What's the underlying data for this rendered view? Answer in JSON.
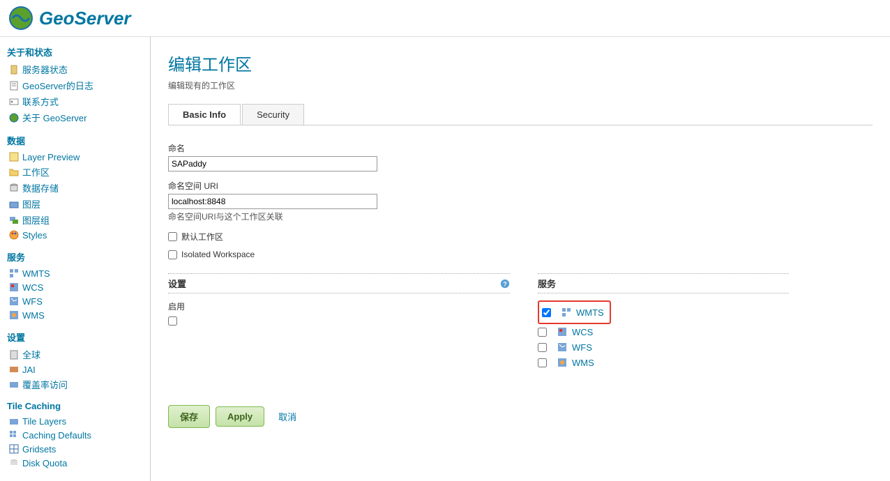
{
  "brand": "GeoServer",
  "sidebar": {
    "groups": [
      {
        "title": "关于和状态",
        "items": [
          {
            "label": "服务器状态",
            "icon": "status-icon"
          },
          {
            "label": "GeoServer的日志",
            "icon": "log-icon"
          },
          {
            "label": "联系方式",
            "icon": "contact-icon"
          },
          {
            "label": "关于 GeoServer",
            "icon": "about-icon"
          }
        ]
      },
      {
        "title": "数据",
        "items": [
          {
            "label": "Layer Preview",
            "icon": "preview-icon"
          },
          {
            "label": "工作区",
            "icon": "folder-icon"
          },
          {
            "label": "数据存储",
            "icon": "store-icon"
          },
          {
            "label": "图层",
            "icon": "layer-icon"
          },
          {
            "label": "图层组",
            "icon": "group-icon"
          },
          {
            "label": "Styles",
            "icon": "style-icon"
          }
        ]
      },
      {
        "title": "服务",
        "items": [
          {
            "label": "WMTS",
            "icon": "wmts-icon"
          },
          {
            "label": "WCS",
            "icon": "wcs-icon"
          },
          {
            "label": "WFS",
            "icon": "wfs-icon"
          },
          {
            "label": "WMS",
            "icon": "wms-icon"
          }
        ]
      },
      {
        "title": "设置",
        "items": [
          {
            "label": "全球",
            "icon": "global-icon"
          },
          {
            "label": "JAI",
            "icon": "jai-icon"
          },
          {
            "label": "覆盖率访问",
            "icon": "coverage-icon"
          }
        ]
      },
      {
        "title": "Tile Caching",
        "items": [
          {
            "label": "Tile Layers",
            "icon": "tilelayer-icon"
          },
          {
            "label": "Caching Defaults",
            "icon": "cachedef-icon"
          },
          {
            "label": "Gridsets",
            "icon": "gridset-icon"
          },
          {
            "label": "Disk Quota",
            "icon": "disk-icon"
          }
        ]
      }
    ]
  },
  "page": {
    "title": "编辑工作区",
    "subtitle": "编辑现有的工作区"
  },
  "tabs": [
    {
      "label": "Basic Info",
      "active": true
    },
    {
      "label": "Security",
      "active": false
    }
  ],
  "form": {
    "name_label": "命名",
    "name_value": "SAPaddy",
    "uri_label": "命名空间 URI",
    "uri_value": "localhost:8848",
    "uri_hint": "命名空间URI与这个工作区关联",
    "default_ws_label": "默认工作区",
    "default_ws_checked": false,
    "isolated_label": "Isolated Workspace",
    "isolated_checked": false
  },
  "settings": {
    "title": "设置",
    "enable_label": "启用",
    "enabled": false
  },
  "services": {
    "title": "服务",
    "items": [
      {
        "label": "WMTS",
        "checked": true,
        "highlighted": true
      },
      {
        "label": "WCS",
        "checked": false,
        "highlighted": false
      },
      {
        "label": "WFS",
        "checked": false,
        "highlighted": false
      },
      {
        "label": "WMS",
        "checked": false,
        "highlighted": false
      }
    ]
  },
  "buttons": {
    "save": "保存",
    "apply": "Apply",
    "cancel": "取消"
  }
}
